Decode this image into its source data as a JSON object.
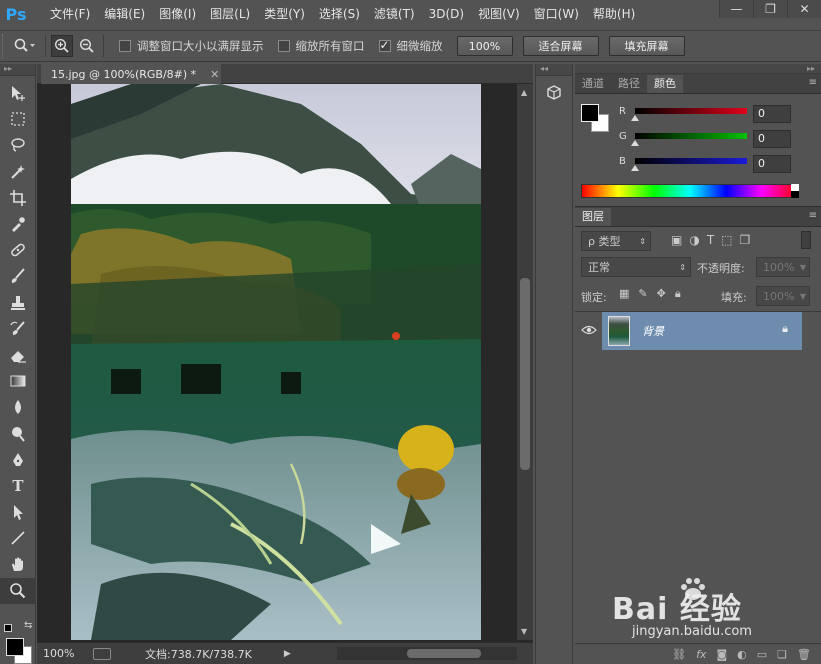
{
  "app": {
    "logo": "Ps"
  },
  "menu": [
    "文件(F)",
    "编辑(E)",
    "图像(I)",
    "图层(L)",
    "类型(Y)",
    "选择(S)",
    "滤镜(T)",
    "3D(D)",
    "视图(V)",
    "窗口(W)",
    "帮助(H)"
  ],
  "window_controls": {
    "minimize": "—",
    "restore": "❐",
    "close": "✕"
  },
  "options": {
    "resize_windows_label": "调整窗口大小以满屏显示",
    "resize_windows_checked": false,
    "zoom_all_label": "缩放所有窗口",
    "zoom_all_checked": false,
    "scrubby_zoom_label": "细微缩放",
    "scrubby_zoom_checked": true,
    "btn_100": "100%",
    "btn_fit": "适合屏幕",
    "btn_fill": "填充屏幕"
  },
  "tools": [
    "move-tool",
    "marquee-tool",
    "lasso-tool",
    "magic-wand-tool",
    "crop-tool",
    "eyedropper-tool",
    "healing-brush-tool",
    "brush-tool",
    "clone-stamp-tool",
    "history-brush-tool",
    "eraser-tool",
    "gradient-tool",
    "blur-tool",
    "dodge-tool",
    "pen-tool",
    "type-tool",
    "path-selection-tool",
    "line-tool",
    "hand-tool",
    "zoom-tool"
  ],
  "document": {
    "tab_title": "15.jpg @ 100%(RGB/8#) *",
    "zoom": "100%",
    "doc_info": "文档:738.7K/738.7K"
  },
  "color_panel": {
    "tabs": [
      "通道",
      "路径",
      "颜色"
    ],
    "active_tab": "颜色",
    "r_label": "R",
    "g_label": "G",
    "b_label": "B",
    "r": "0",
    "g": "0",
    "b": "0",
    "r_color": "#e0001b",
    "g_color": "#00c000",
    "b_color": "#1a1ad8"
  },
  "layers_panel": {
    "title": "图层",
    "filter_kind": "ρ 类型",
    "blend_mode": "正常",
    "opacity_label": "不透明度:",
    "opacity_value": "100%",
    "lock_label": "锁定:",
    "fill_label": "填充:",
    "fill_value": "100%",
    "layers": [
      {
        "name": "背景",
        "visible": true,
        "locked": true,
        "selected": true
      }
    ]
  },
  "watermark": {
    "brand": "Bai 经验",
    "url": "jingyan.baidu.com"
  }
}
